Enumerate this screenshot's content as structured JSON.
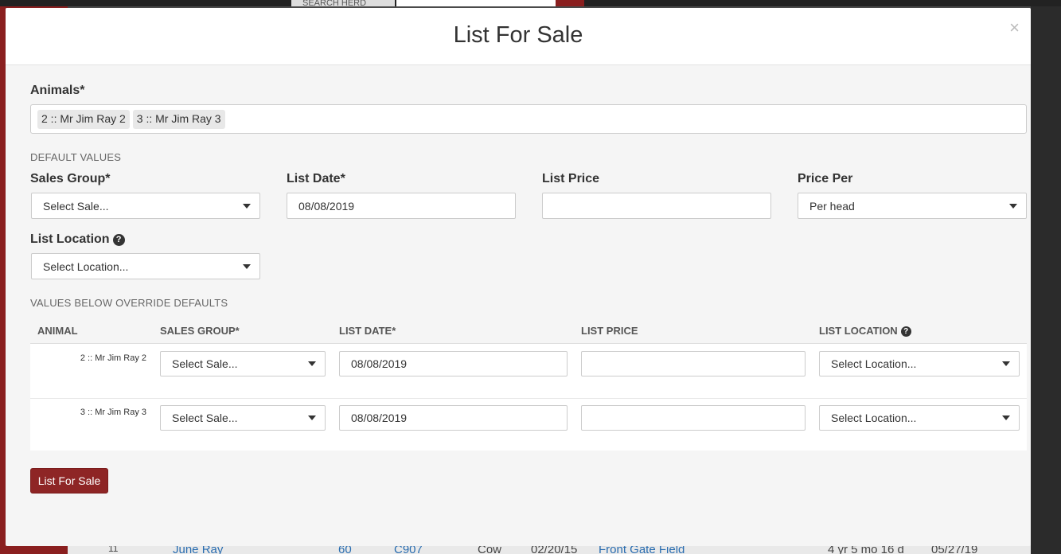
{
  "background": {
    "search_label": "SEARCH HERD",
    "table_row": [
      "11",
      "June Ray",
      "60",
      "C907",
      "Cow",
      "02/20/15",
      "Front Gate Field",
      "4 yr 5 mo 16 d",
      "05/27/19"
    ]
  },
  "modal": {
    "title": "List For Sale",
    "close_label": "×",
    "animals_label": "Animals*",
    "animals": [
      "2 :: Mr Jim Ray 2",
      "3 :: Mr Jim Ray 3"
    ],
    "defaults": {
      "section_label": "DEFAULT VALUES",
      "sales_group_label": "Sales Group*",
      "sales_group_value": "Select Sale...",
      "list_date_label": "List Date*",
      "list_date_value": "08/08/2019",
      "list_price_label": "List Price",
      "list_price_value": "",
      "price_per_label": "Price Per",
      "price_per_value": "Per head",
      "list_location_label": "List Location",
      "list_location_value": "Select Location..."
    },
    "overrides": {
      "section_label": "VALUES BELOW OVERRIDE DEFAULTS",
      "columns": [
        "ANIMAL",
        "SALES GROUP*",
        "LIST DATE*",
        "LIST PRICE",
        "LIST LOCATION"
      ],
      "rows": [
        {
          "animal": "2 :: Mr Jim Ray 2",
          "sales_group": "Select Sale...",
          "list_date": "08/08/2019",
          "list_price": "",
          "list_location": "Select Location..."
        },
        {
          "animal": "3 :: Mr Jim Ray 3",
          "sales_group": "Select Sale...",
          "list_date": "08/08/2019",
          "list_price": "",
          "list_location": "Select Location..."
        }
      ]
    },
    "submit_label": "List For Sale"
  },
  "colors": {
    "accent": "#8e2525",
    "modal_bg": "#f5f5f5"
  },
  "icons": {
    "help": "question-circle-icon",
    "close": "close-icon",
    "dropdown": "caret-down-icon"
  }
}
